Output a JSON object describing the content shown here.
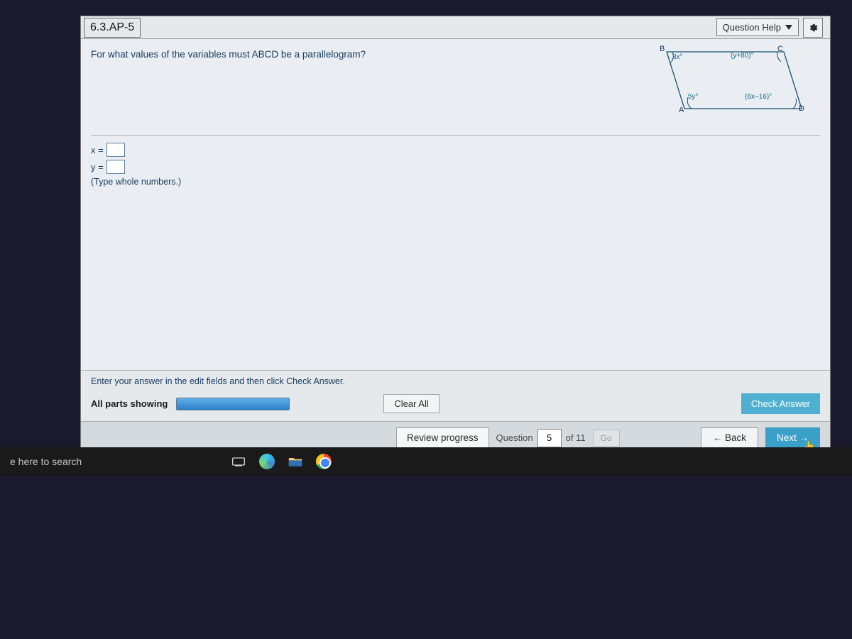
{
  "title": "6.3.AP-5",
  "help_button": "Question Help",
  "question_text": "For what values of the variables must ABCD be a parallelogram?",
  "diagram": {
    "vertices": {
      "B": "B",
      "C": "C",
      "A": "A",
      "D": "D"
    },
    "angles": {
      "top_left": "3x°",
      "top_right": "(y+80)°",
      "bottom_left": "5y°",
      "bottom_right": "(6x−16)°"
    }
  },
  "answers": {
    "x_label": "x =",
    "y_label": "y =",
    "x_value": "",
    "y_value": "",
    "hint": "(Type whole numbers.)"
  },
  "footer": {
    "instruction": "Enter your answer in the edit fields and then click Check Answer.",
    "all_parts": "All parts showing",
    "clear_all": "Clear All",
    "check": "Check Answer"
  },
  "nav": {
    "review": "Review progress",
    "question_label": "Question",
    "current": "5",
    "of_label": "of 11",
    "go": "Go",
    "back": "← Back",
    "next": "Next →"
  },
  "taskbar": {
    "search_hint": "e here to search"
  }
}
